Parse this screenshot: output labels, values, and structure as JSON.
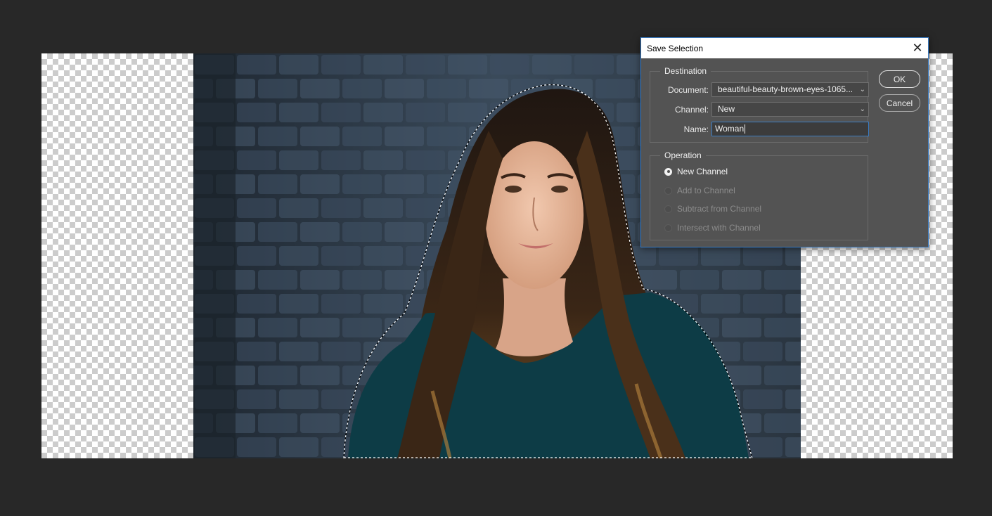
{
  "dialog": {
    "title": "Save Selection",
    "close_icon": "close-icon",
    "destination": {
      "group_label": "Destination",
      "document_label": "Document:",
      "document_value": "beautiful-beauty-brown-eyes-1065...",
      "channel_label": "Channel:",
      "channel_value": "New",
      "name_label": "Name:",
      "name_value": "Woman"
    },
    "operation": {
      "group_label": "Operation",
      "options": [
        {
          "label": "New Channel",
          "selected": true,
          "enabled": true
        },
        {
          "label": "Add to Channel",
          "selected": false,
          "enabled": false
        },
        {
          "label": "Subtract from Channel",
          "selected": false,
          "enabled": false
        },
        {
          "label": "Intersect with Channel",
          "selected": false,
          "enabled": false
        }
      ]
    },
    "buttons": {
      "ok": "OK",
      "cancel": "Cancel"
    }
  },
  "canvas": {
    "background": "transparent-checkerboard",
    "selection": "marching-ants-outline-woman"
  },
  "colors": {
    "workspace": "#282828",
    "dialog_bg": "#535353",
    "accent": "#3a7cc4"
  }
}
